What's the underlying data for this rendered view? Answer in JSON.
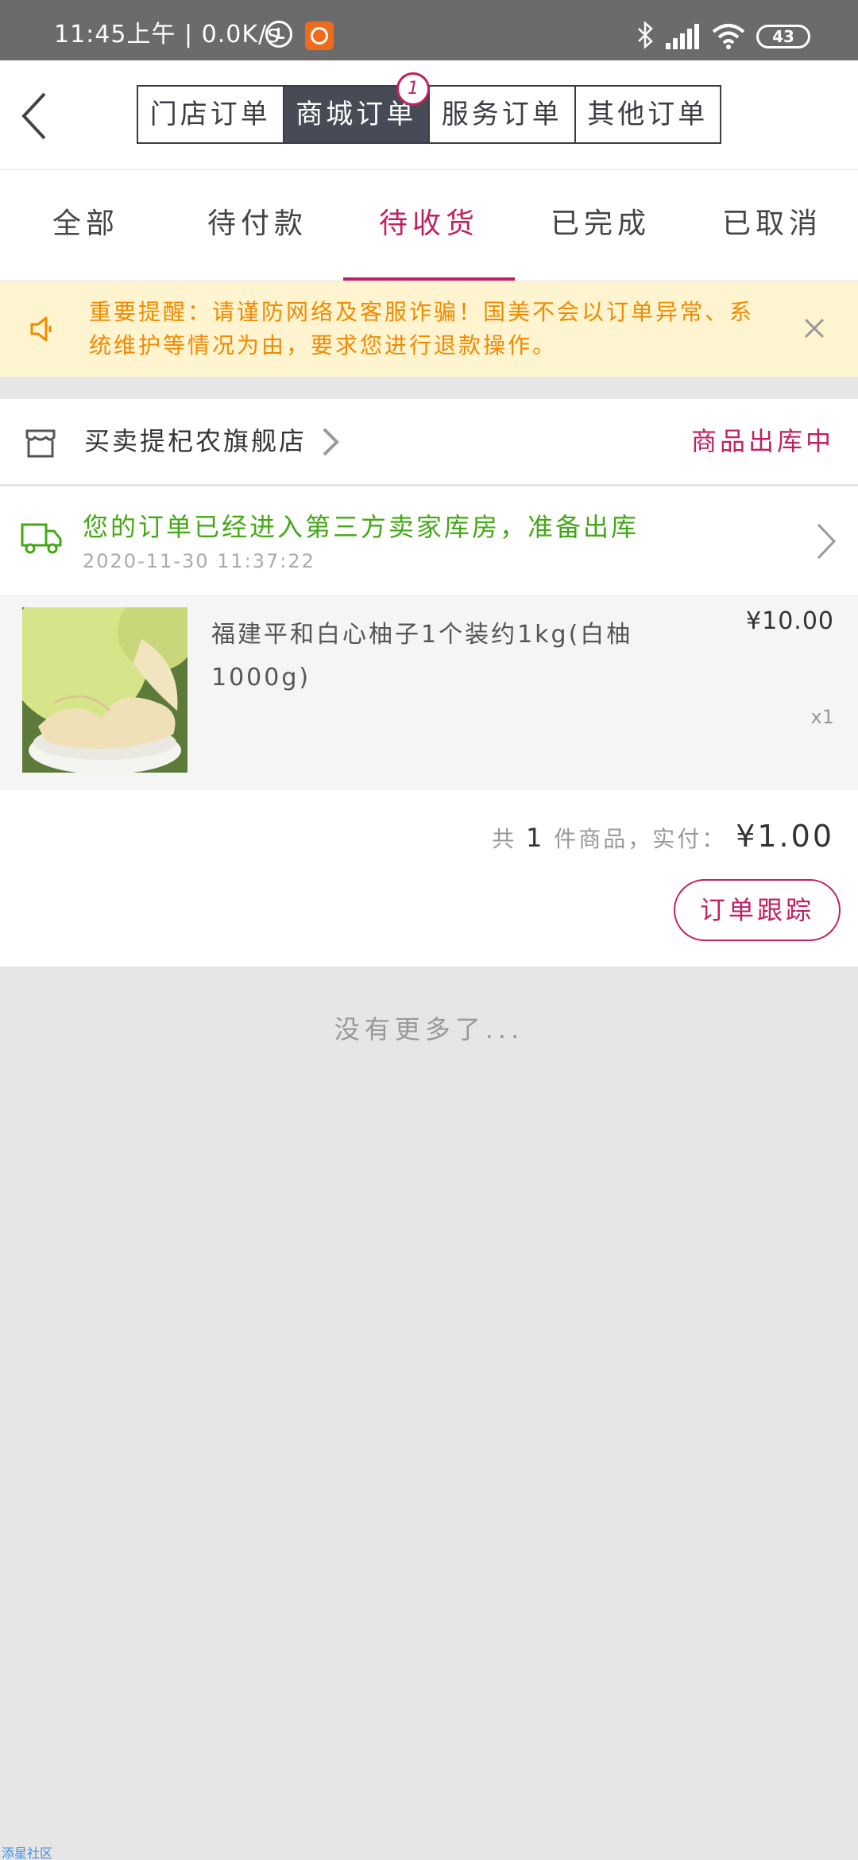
{
  "status_bar": {
    "time_text": "11:45上午 | 0.0K/s",
    "battery": "43"
  },
  "header": {
    "segments": [
      {
        "label": "门店订单"
      },
      {
        "label": "商城订单",
        "badge": "1"
      },
      {
        "label": "服务订单"
      },
      {
        "label": "其他订单"
      }
    ]
  },
  "tabs": [
    {
      "label": "全部"
    },
    {
      "label": "待付款"
    },
    {
      "label": "待收货"
    },
    {
      "label": "已完成"
    },
    {
      "label": "已取消"
    }
  ],
  "notice": {
    "text": "重要提醒：请谨防网络及客服诈骗！国美不会以订单异常、系统维护等情况为由，要求您进行退款操作。"
  },
  "order": {
    "shop_name": "买卖提杞农旗舰店",
    "status": "商品出库中",
    "logistics_text": "您的订单已经进入第三方卖家库房，准备出库",
    "logistics_time": "2020-11-30 11:37:22",
    "product_name": "福建平和白心柚子1个装约1kg(白柚 1000g)",
    "price": "¥10.00",
    "qty": "x1",
    "summary_prefix": "共",
    "summary_count": "1",
    "summary_mid": "件商品，实付：",
    "summary_amount": "¥1.00",
    "track_button": "订单跟踪"
  },
  "footer": {
    "no_more": "没有更多了...",
    "watermark": "添星社区"
  },
  "colors": {
    "accent": "#c21f62",
    "notice_text": "#f08a00",
    "logistics_green": "#44a816"
  }
}
